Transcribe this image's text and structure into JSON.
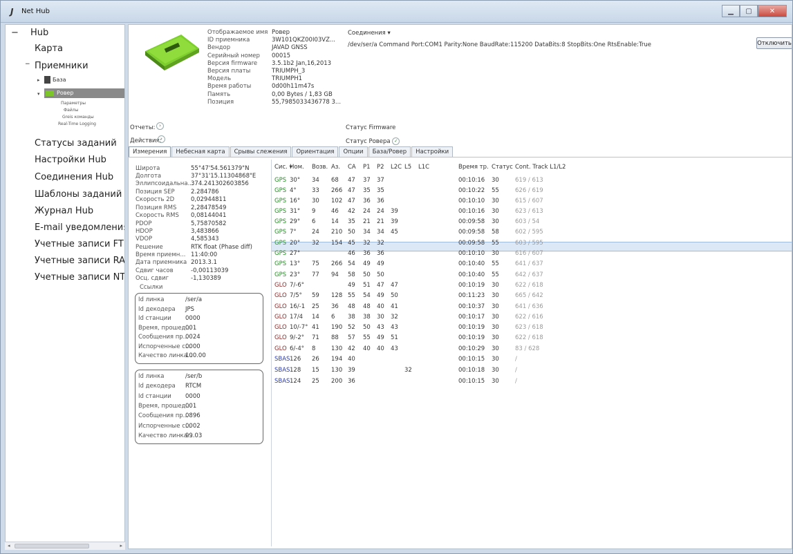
{
  "window": {
    "title": "Net Hub",
    "icon": "nethub-logo-icon"
  },
  "sidebar": {
    "hub": "Hub",
    "map": "Карта",
    "receivers": "Приемники",
    "base": "База",
    "rover": "Ровер",
    "rover_sub": [
      "Параметры",
      "Файлы",
      "Greis команды",
      "Real-Time Logging"
    ],
    "items": [
      "Статусы заданий",
      "Настройки Hub",
      "Соединения Hub",
      "Шаблоны заданий",
      "Журнал Hub",
      "E-mail уведомления",
      "Учетные записи FTP",
      "Учетные записи RAW",
      "Учетные записи NTRIP"
    ]
  },
  "receiver": {
    "labels": [
      "Отображаемое имя",
      "ID приемника",
      "Вендор",
      "Серийный номер",
      "Версия firmware",
      "Версия платы",
      "Модель",
      "Время работы",
      "Память",
      "Позиция"
    ],
    "values": [
      "Ровер",
      "3W101QKZ00I03VZ...",
      "JAVAD GNSS",
      "00015",
      "3.5.1b2 Jan,16,2013",
      "TRIUMPH_3",
      "TRIUMPH1",
      "0d00h11m47s",
      "0,00 Bytes / 1,83 GB",
      "55,7985033436778 3..."
    ],
    "reports": "Отчеты:",
    "actions": "Действия:",
    "connections": "Соединения",
    "connection_line": "/dev/ser/a Command Port:COM1 Parity:None BaudRate:115200 DataBits:8 StopBits:One RtsEnable:True",
    "disconnect": "Отключить",
    "fw_status": "Статус Firmware",
    "rover_status": "Статус Ровера"
  },
  "tabs": [
    "Измерения",
    "Небесная карта",
    "Срывы слежения",
    "Ориентация",
    "Опции",
    "База/Ровер",
    "Настройки"
  ],
  "measurements": {
    "labels": [
      "Широта",
      "Долгота",
      "Эллипсоидальна...",
      "Позиция SEP",
      "Скорость 2D",
      "Позиция RMS",
      "Скорость RMS",
      "PDOP",
      "HDOP",
      "VDOP",
      "Решение",
      "Время приемн...",
      "Дата приемника",
      "Сдвиг часов",
      "Осц. сдвиг"
    ],
    "values": [
      "55°47'54.561379\"N",
      "37°31'15.11304868\"E",
      "374.241302603856",
      "2.284786",
      "0,02944811",
      "2,28478549",
      "0,08144041",
      "5,75870582",
      "3,483866",
      "4,585343",
      "RTK float (Phase diff)",
      "11:40:00",
      "2013.3.1",
      "-0,00113039",
      "-1,130389"
    ],
    "links_title": "Ссылки",
    "link_labels": [
      "Id линка",
      "Id декодера",
      "Id станции",
      "Время, прошед...",
      "Сообщения пр...",
      "Испорченные с...",
      "Качество линка..."
    ],
    "link1": [
      "/ser/a",
      "JPS",
      "0000",
      "001",
      "0024",
      "0000",
      "100.00"
    ],
    "link2": [
      "/ser/b",
      "RTCM",
      "0000",
      "001",
      "0896",
      "0002",
      "99.03"
    ]
  },
  "sat_table": {
    "headers": [
      "Сис. ▾",
      "Ном.",
      "Возв.",
      "Аз.",
      "CA",
      "P1",
      "P2",
      "L2C",
      "L5",
      "L1C",
      "Время тр.",
      "Статус",
      "Cont. Track L1/L2"
    ],
    "rows": [
      [
        "GPS",
        "30°",
        "34",
        "68",
        "47",
        "37",
        "37",
        "",
        "",
        "",
        "00:10:16",
        "30",
        "619 / 613"
      ],
      [
        "GPS",
        "4°",
        "33",
        "266",
        "47",
        "35",
        "35",
        "",
        "",
        "",
        "00:10:22",
        "55",
        "626 / 619"
      ],
      [
        "GPS",
        "16°",
        "30",
        "102",
        "47",
        "36",
        "36",
        "",
        "",
        "",
        "00:10:10",
        "30",
        "615 / 607"
      ],
      [
        "GPS",
        "31°",
        "9",
        "46",
        "42",
        "24",
        "24",
        "39",
        "",
        "",
        "00:10:16",
        "30",
        "623 / 613"
      ],
      [
        "GPS",
        "29°",
        "6",
        "14",
        "35",
        "21",
        "21",
        "39",
        "",
        "",
        "00:09:58",
        "30",
        "603 / 54"
      ],
      [
        "GPS",
        "7°",
        "24",
        "210",
        "50",
        "34",
        "34",
        "45",
        "",
        "",
        "00:09:58",
        "58",
        "602 / 595"
      ],
      [
        "GPS",
        "20°",
        "32",
        "154",
        "45",
        "32",
        "32",
        "",
        "",
        "",
        "00:09:58",
        "55",
        "603 / 595"
      ],
      [
        "GPS",
        "27°",
        "",
        "",
        "46",
        "36",
        "36",
        "",
        "",
        "",
        "00:10:10",
        "30",
        "616 / 607"
      ],
      [
        "GPS",
        "13°",
        "75",
        "266",
        "54",
        "49",
        "49",
        "",
        "",
        "",
        "00:10:40",
        "55",
        "641 / 637"
      ],
      [
        "GPS",
        "23°",
        "77",
        "94",
        "58",
        "50",
        "50",
        "",
        "",
        "",
        "00:10:40",
        "55",
        "642 / 637"
      ],
      [
        "GLO",
        "7/-6°",
        "",
        "",
        "49",
        "51",
        "47",
        "47",
        "",
        "",
        "00:10:19",
        "30",
        "622 / 618"
      ],
      [
        "GLO",
        "7/5°",
        "59",
        "128",
        "55",
        "54",
        "49",
        "50",
        "",
        "",
        "00:11:23",
        "30",
        "665 / 642"
      ],
      [
        "GLO",
        "16/-1",
        "25",
        "36",
        "48",
        "48",
        "40",
        "41",
        "",
        "",
        "00:10:37",
        "30",
        "641 / 636"
      ],
      [
        "GLO",
        "17/4",
        "14",
        "6",
        "38",
        "38",
        "30",
        "32",
        "",
        "",
        "00:10:17",
        "30",
        "622 / 616"
      ],
      [
        "GLO",
        "10/-7°",
        "41",
        "190",
        "52",
        "50",
        "43",
        "43",
        "",
        "",
        "00:10:19",
        "30",
        "623 / 618"
      ],
      [
        "GLO",
        "9/-2°",
        "71",
        "88",
        "57",
        "55",
        "49",
        "51",
        "",
        "",
        "00:10:19",
        "30",
        "622 / 618"
      ],
      [
        "GLO",
        "6/-4°",
        "8",
        "130",
        "42",
        "40",
        "40",
        "43",
        "",
        "",
        "00:10:29",
        "30",
        "83 / 628"
      ],
      [
        "SBAS",
        "126",
        "26",
        "194",
        "40",
        "",
        "",
        "",
        "",
        "",
        "00:10:15",
        "30",
        "/"
      ],
      [
        "SBAS",
        "128",
        "15",
        "130",
        "39",
        "",
        "",
        "",
        "32",
        "",
        "00:10:18",
        "30",
        "/"
      ],
      [
        "SBAS",
        "124",
        "25",
        "200",
        "36",
        "",
        "",
        "",
        "",
        "",
        "00:10:15",
        "30",
        "/"
      ]
    ]
  }
}
